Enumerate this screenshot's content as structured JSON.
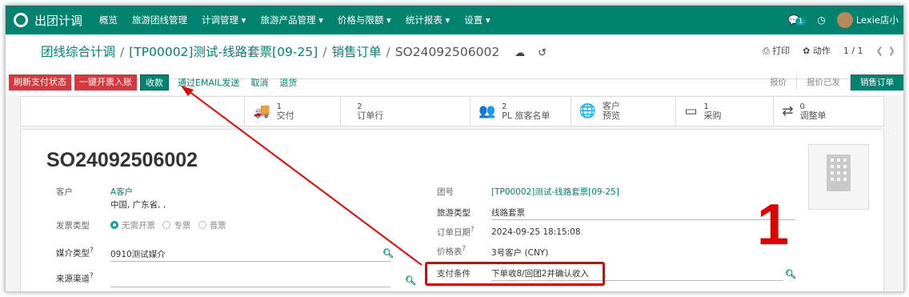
{
  "navbar": {
    "app_name": "出团计调",
    "items": [
      "概览",
      "旅游团线管理",
      "计调管理 ▾",
      "旅游产品管理 ▾",
      "价格与限额 ▾",
      "统计报表 ▾",
      "设置 ▾"
    ],
    "chat_count": "1",
    "username": "Lexie店小"
  },
  "breadcrumb": {
    "part1": "团线综合计调",
    "sep": "/",
    "part2": "[TP00002]测试-线路套票[09-25]",
    "part3": "销售订单",
    "current": "SO24092506002"
  },
  "pager": {
    "print": "⎙ 打印",
    "action": "✿ 动作",
    "count": "1 / 1"
  },
  "actions": {
    "refresh_payment": "刷新支付状态",
    "one_click_invoice": "一键开票入账",
    "receive": "收款",
    "send_email": "通过EMAIL发送",
    "cancel": "取消",
    "return": "退货"
  },
  "stages": [
    "报价",
    "报价已发",
    "销售订单"
  ],
  "stats": [
    {
      "num": "1",
      "label": "交付",
      "icon": "truck-icon"
    },
    {
      "num": "2",
      "label": "订单行",
      "icon": ""
    },
    {
      "num": "2",
      "label": "PL 旅客名单",
      "icon": "users-icon"
    },
    {
      "num": "",
      "label": "客户 预览",
      "icon": "globe-icon"
    },
    {
      "num": "1",
      "label": "采购",
      "icon": "card-icon"
    },
    {
      "num": "0",
      "label": "调整单",
      "icon": "exchange-icon"
    }
  ],
  "form": {
    "title": "SO24092506002",
    "customer_label": "客户",
    "customer": "A客户",
    "customer_address": "中国, 广东省, ,",
    "invoice_type_label": "发票类型",
    "invoice_options": [
      "无需开票",
      "专票",
      "普票"
    ],
    "media_type_label": "媒介类型",
    "media_type": "0910测试媒介",
    "source_label": "来源渠道",
    "source": "",
    "group_no_label": "团号",
    "group_no": "[TP00002]测试-线路套票[09-25]",
    "tour_type_label": "旅游类型",
    "tour_type": "线路套票",
    "order_date_label": "订单日期",
    "order_date": "2024-09-25 18:15:08",
    "pricelist_label": "价格表",
    "pricelist": "3号客户 (CNY)",
    "payment_terms_label": "支付条件",
    "payment_terms": "下单收8/回团2并确认收入",
    "help_mark": "?"
  },
  "annotation": {
    "number": "1"
  },
  "colors": {
    "navbar": "#00826f",
    "accent": "#00826f",
    "danger": "#d9363e",
    "annotation": "#e00000"
  }
}
